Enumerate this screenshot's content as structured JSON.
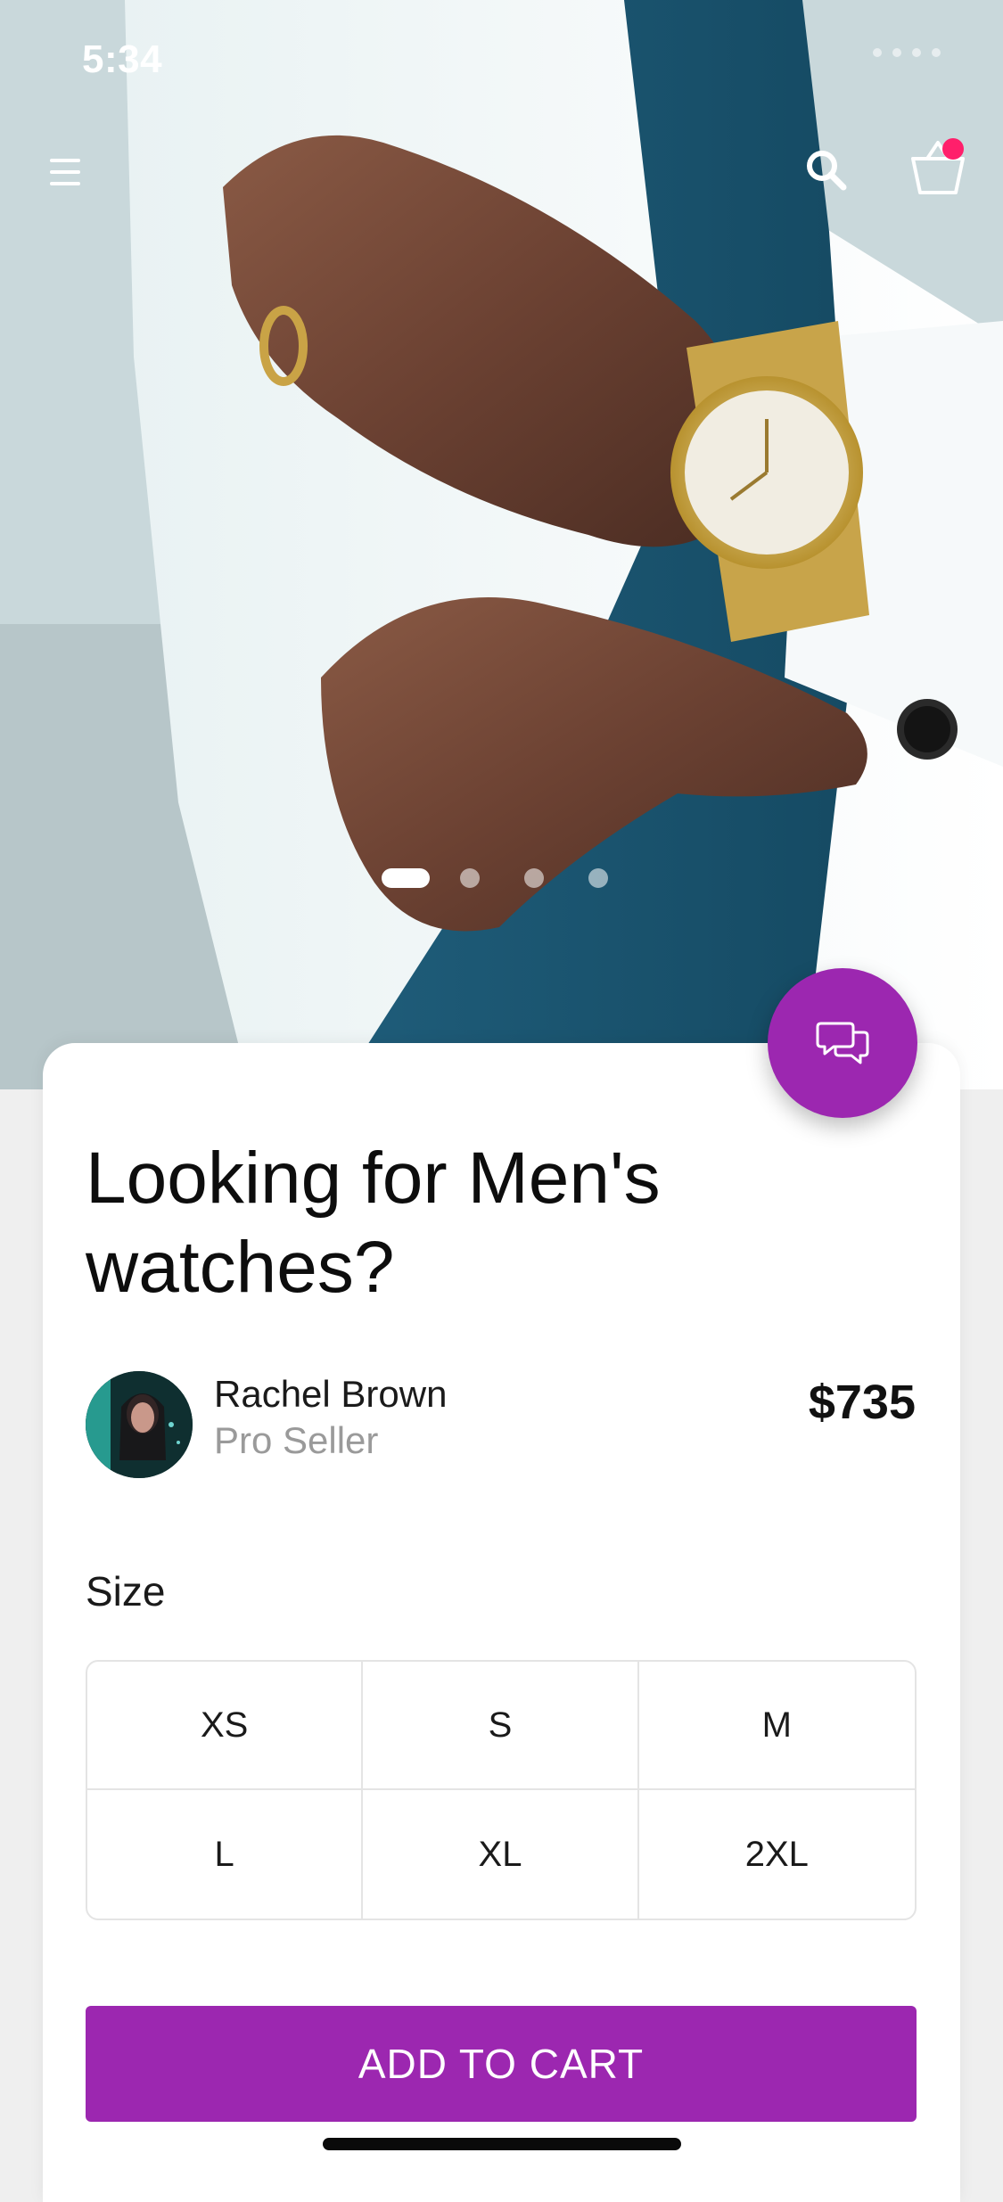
{
  "status_bar": {
    "time": "5:34"
  },
  "nav": {
    "menu_icon": "hamburger-menu-icon",
    "search_icon": "search-icon",
    "cart_icon": "shopping-basket-icon",
    "cart_has_notification": true
  },
  "carousel": {
    "slides": 4,
    "active_index": 0
  },
  "product": {
    "title": "Looking for Men's watches?",
    "price": "$735"
  },
  "seller": {
    "name": "Rachel Brown",
    "role": "Pro Seller"
  },
  "size": {
    "label": "Size",
    "options": [
      "XS",
      "S",
      "M",
      "L",
      "XL",
      "2XL"
    ]
  },
  "actions": {
    "add_to_cart_label": "ADD TO CART",
    "chat_icon": "chat-bubbles-icon"
  },
  "colors": {
    "accent": "#9c27b0",
    "notification": "#ff1f6b"
  }
}
